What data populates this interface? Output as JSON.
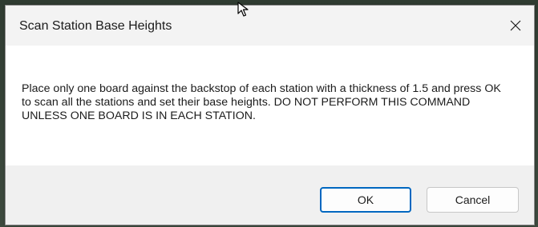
{
  "dialog": {
    "title": "Scan Station Base Heights",
    "message": "Place only one board against the backstop of each station with a thickness of 1.5 and press OK to scan all the stations and set their base heights.  DO NOT PERFORM THIS COMMAND UNLESS ONE BOARD IS IN EACH STATION.",
    "close_icon": "close-icon",
    "cursor_icon": "mouse-pointer-icon"
  },
  "buttons": {
    "ok_label": "OK",
    "cancel_label": "Cancel"
  },
  "colors": {
    "accent": "#0067c0",
    "titlebar": "#f3f3f3",
    "footer": "#f0f0f0"
  }
}
